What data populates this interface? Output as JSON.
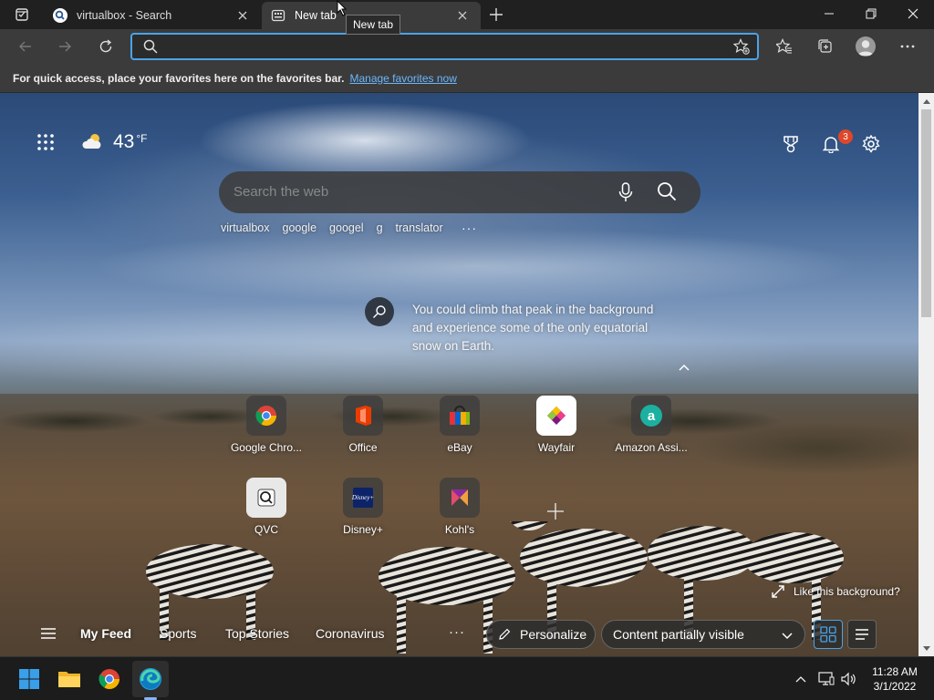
{
  "browser": {
    "tabs": [
      {
        "title": "virtualbox - Search",
        "active": false
      },
      {
        "title": "New tab",
        "active": true
      }
    ],
    "tooltip": "New tab",
    "address_value": "",
    "favorites_bar": {
      "message": "For quick access, place your favorites here on the favorites bar.",
      "link": "Manage favorites now"
    }
  },
  "ntp": {
    "weather": {
      "temperature": "43",
      "unit": "°F",
      "icon": "partly-cloudy-icon"
    },
    "notifications_count": "3",
    "search_placeholder": "Search the web",
    "recent_searches": [
      "virtualbox",
      "google",
      "googel",
      "g",
      "translator"
    ],
    "more_glyph": "···",
    "fact": "You could climb that peak in the background and experience some of the only equatorial snow on Earth.",
    "tiles": [
      {
        "label": "Google Chro...",
        "icon": "chrome-icon"
      },
      {
        "label": "Office",
        "icon": "office-icon"
      },
      {
        "label": "eBay",
        "icon": "ebay-icon"
      },
      {
        "label": "Wayfair",
        "icon": "wayfair-icon"
      },
      {
        "label": "Amazon Assi...",
        "icon": "amazon-icon"
      },
      {
        "label": "QVC",
        "icon": "qvc-icon"
      },
      {
        "label": "Disney+",
        "icon": "disney-icon"
      },
      {
        "label": "Kohl's",
        "icon": "kohls-icon"
      }
    ],
    "like_background": "Like this background?",
    "feed": {
      "tabs": [
        "My Feed",
        "Sports",
        "Top Stories",
        "Coronavirus"
      ],
      "personalize": "Personalize",
      "content_visibility": "Content partially visible"
    }
  },
  "taskbar": {
    "time": "11:28 AM",
    "date": "3/1/2022"
  },
  "colors": {
    "accent": "#4aa3e8",
    "badge": "#e0462a",
    "link": "#6ab7ff"
  }
}
